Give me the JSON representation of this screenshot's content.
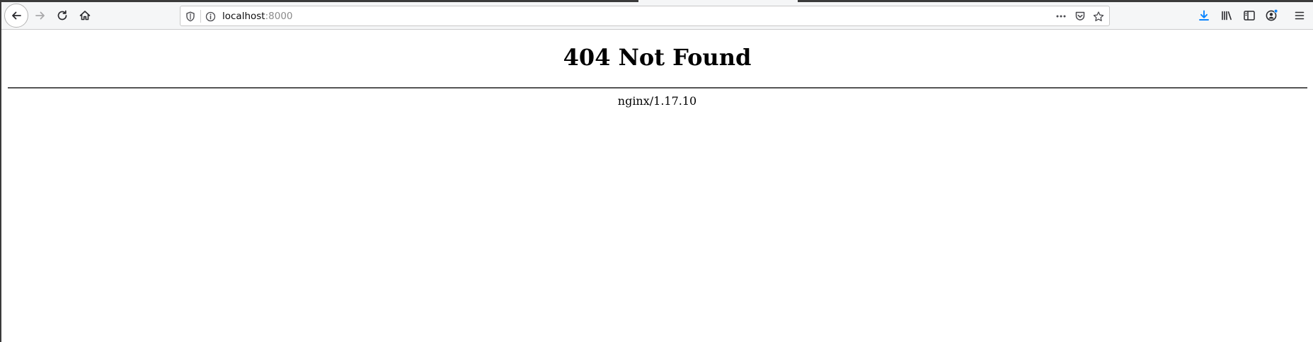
{
  "browser": {
    "address_bar": {
      "host": "localhost",
      "port": ":8000"
    },
    "icons": {
      "back": "arrow-left-icon",
      "forward": "arrow-right-icon",
      "reload": "reload-icon",
      "home": "home-icon",
      "tracking_protection": "shield-icon",
      "site_info": "info-icon",
      "page_actions": "more-dots-icon",
      "pocket": "pocket-icon",
      "bookmark": "star-icon",
      "downloads": "download-icon",
      "library": "library-icon",
      "sidebar": "sidebar-icon",
      "account": "account-icon",
      "menu": "hamburger-menu-icon"
    },
    "colors": {
      "toolbar_bg": "#f5f6f7",
      "download_accent": "#0a84ff"
    }
  },
  "page": {
    "heading": "404 Not Found",
    "server_signature": "nginx/1.17.10"
  }
}
